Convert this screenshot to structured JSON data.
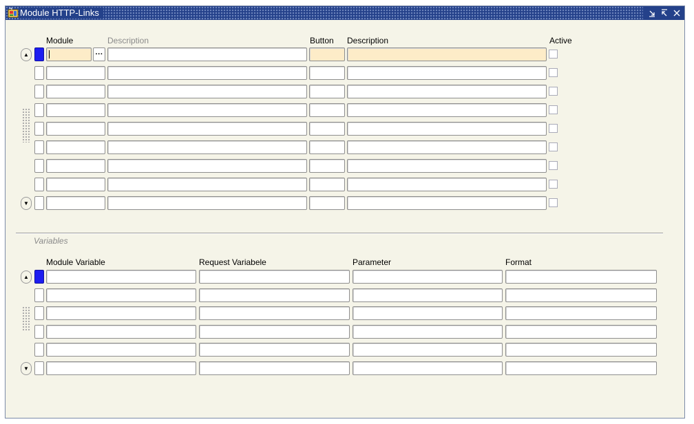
{
  "window": {
    "title": "Module HTTP-Links",
    "icon": "app-window-icon",
    "controls": [
      "minimize-icon",
      "maximize-icon",
      "close-icon"
    ],
    "title_color": "#24418a"
  },
  "links": {
    "headers": {
      "module": "Module",
      "description": "Description",
      "button": "Button",
      "button_description": "Description",
      "active": "Active"
    },
    "row_count": 9,
    "current_row": 1,
    "required_field_color": "#fdecc8",
    "rows": [
      {
        "module": "",
        "description": "",
        "button": "",
        "button_description": "",
        "active": false
      },
      {
        "module": "",
        "description": "",
        "button": "",
        "button_description": "",
        "active": false
      },
      {
        "module": "",
        "description": "",
        "button": "",
        "button_description": "",
        "active": false
      },
      {
        "module": "",
        "description": "",
        "button": "",
        "button_description": "",
        "active": false
      },
      {
        "module": "",
        "description": "",
        "button": "",
        "button_description": "",
        "active": false
      },
      {
        "module": "",
        "description": "",
        "button": "",
        "button_description": "",
        "active": false
      },
      {
        "module": "",
        "description": "",
        "button": "",
        "button_description": "",
        "active": false
      },
      {
        "module": "",
        "description": "",
        "button": "",
        "button_description": "",
        "active": false
      },
      {
        "module": "",
        "description": "",
        "button": "",
        "button_description": "",
        "active": false
      }
    ],
    "lov_glyph": "···"
  },
  "variables": {
    "section_label": "Variables",
    "headers": {
      "module_variable": "Module Variable",
      "request_variable": "Request Variabele",
      "parameter": "Parameter",
      "format": "Format"
    },
    "row_count": 6,
    "current_row": 1,
    "rows": [
      {
        "module_variable": "",
        "request_variable": "",
        "parameter": "",
        "format": ""
      },
      {
        "module_variable": "",
        "request_variable": "",
        "parameter": "",
        "format": ""
      },
      {
        "module_variable": "",
        "request_variable": "",
        "parameter": "",
        "format": ""
      },
      {
        "module_variable": "",
        "request_variable": "",
        "parameter": "",
        "format": ""
      },
      {
        "module_variable": "",
        "request_variable": "",
        "parameter": "",
        "format": ""
      },
      {
        "module_variable": "",
        "request_variable": "",
        "parameter": "",
        "format": ""
      }
    ]
  },
  "scroll_icons": {
    "up": "scroll-up-icon",
    "down": "scroll-down-icon"
  }
}
